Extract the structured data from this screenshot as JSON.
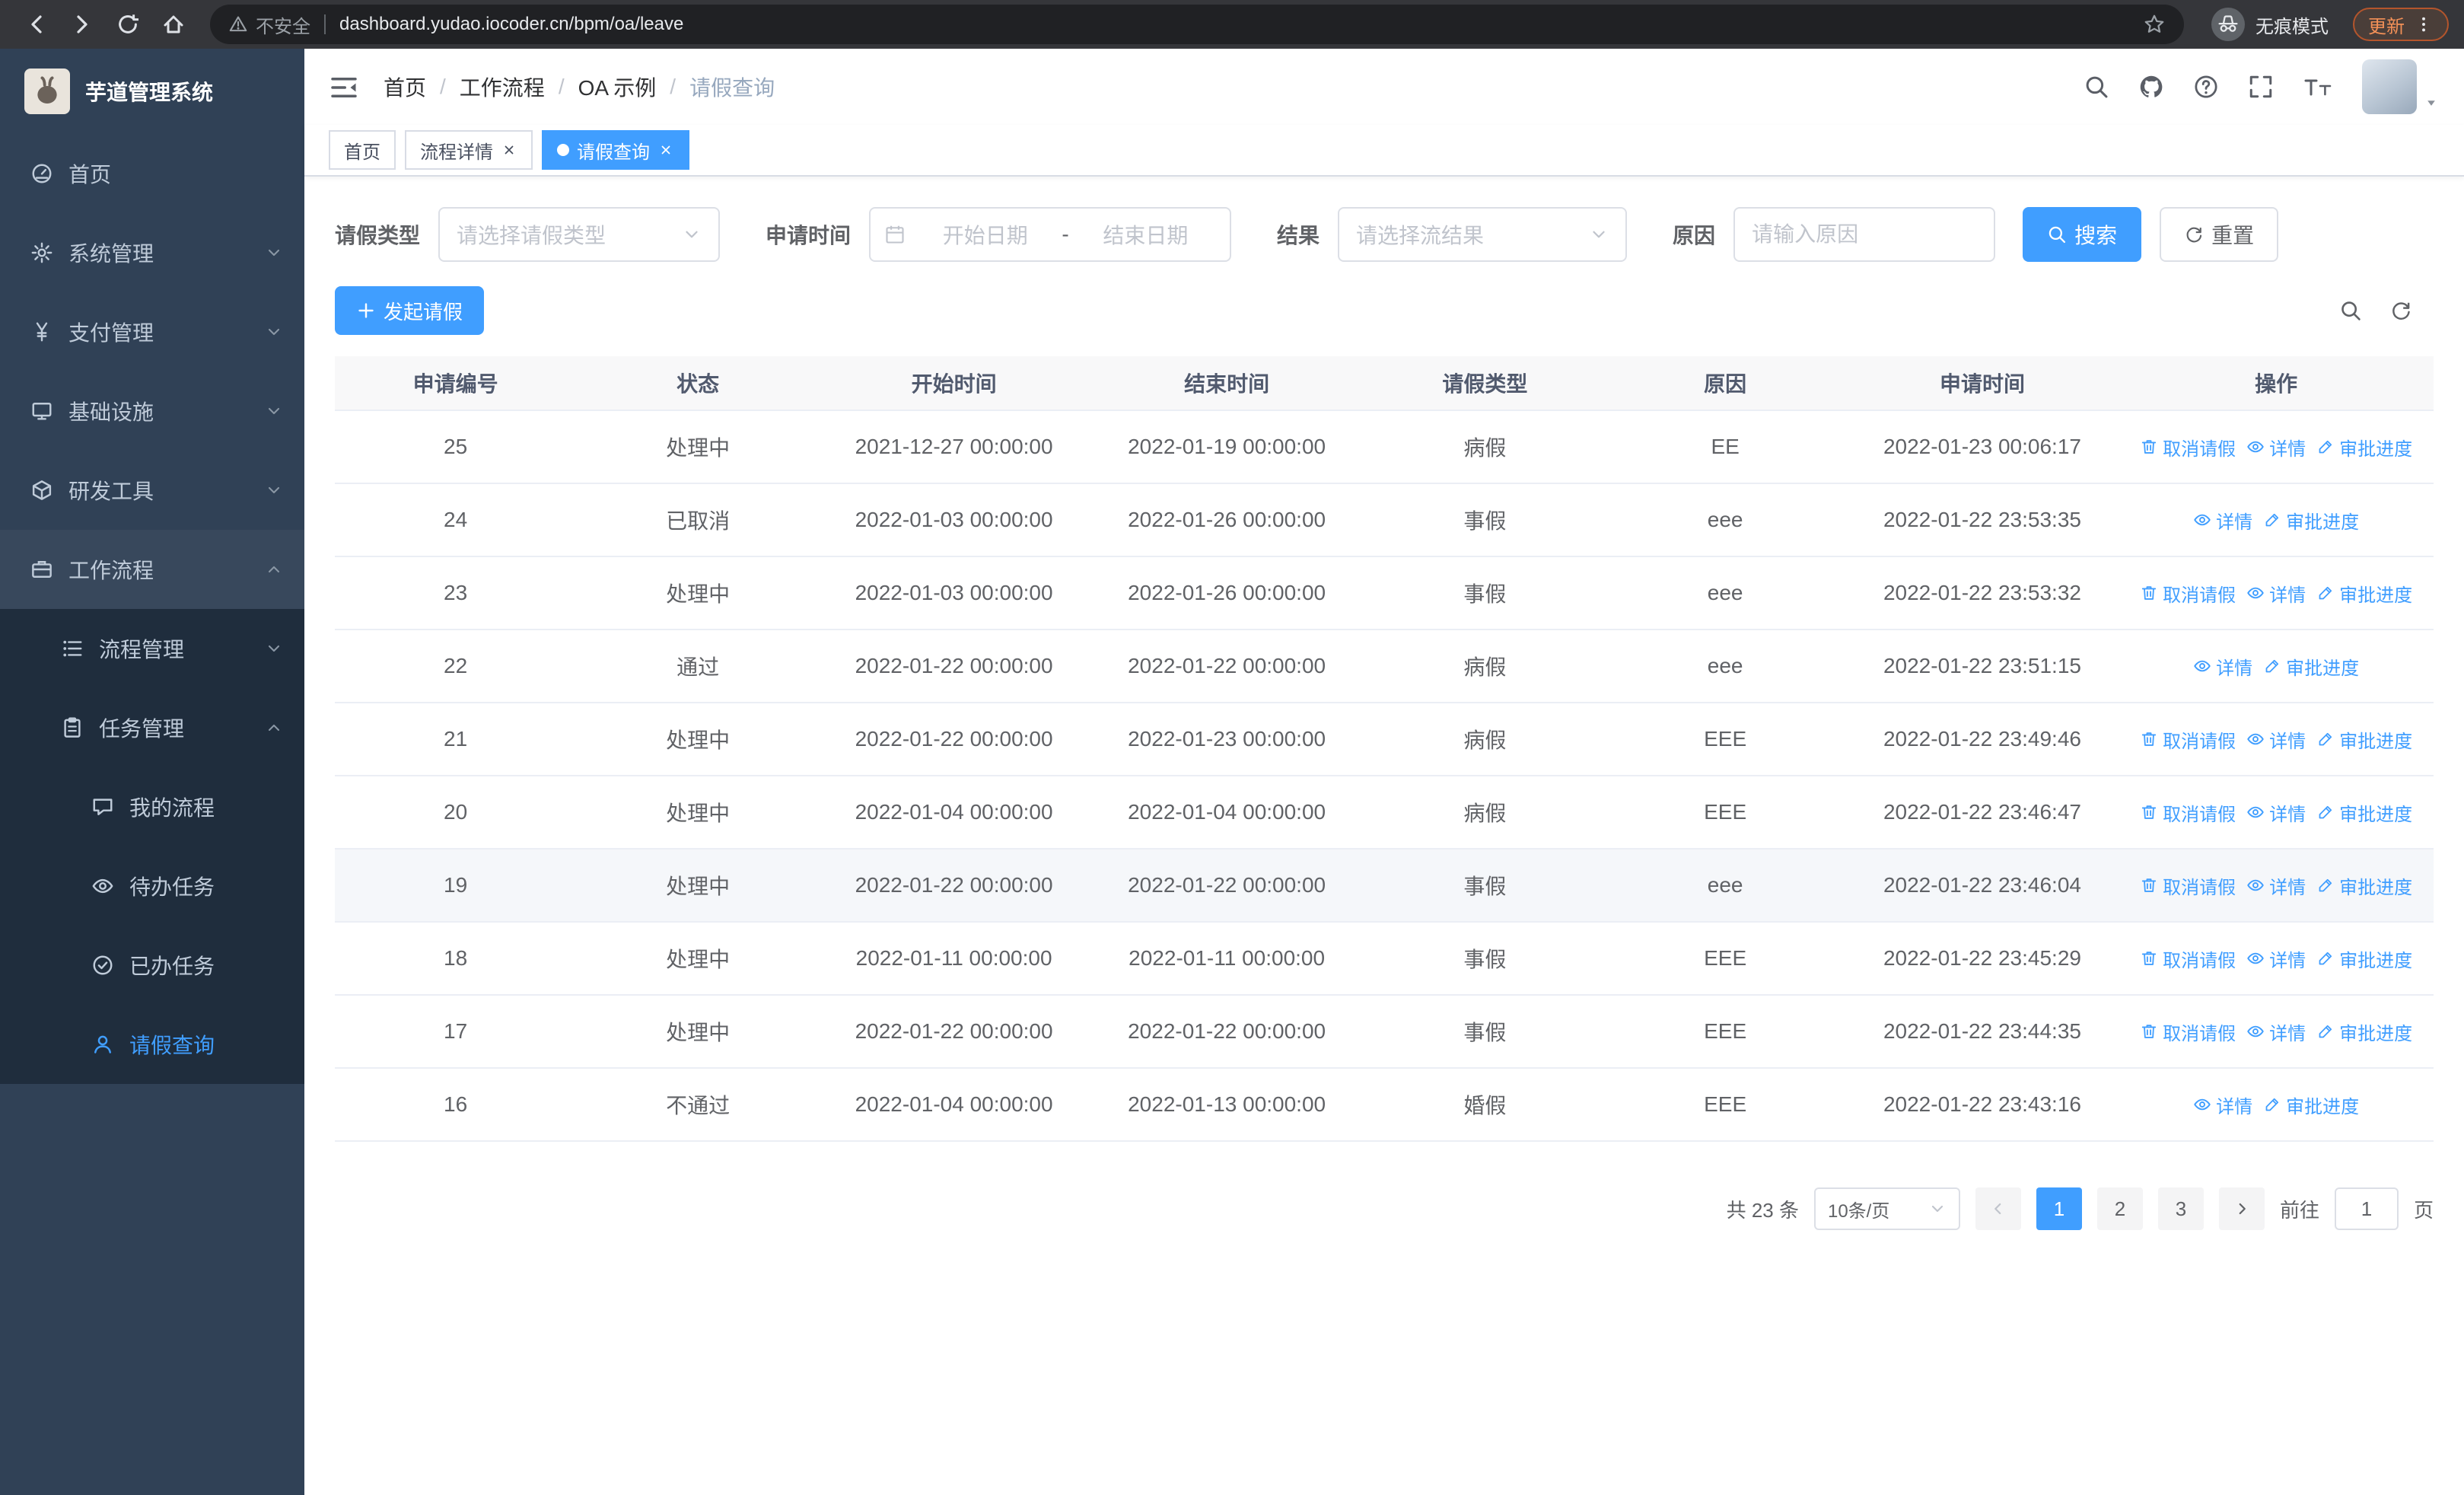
{
  "browser": {
    "security_warning": "不安全",
    "url": "dashboard.yudao.iocoder.cn/bpm/oa/leave",
    "incognito_label": "无痕模式",
    "update_label": "更新"
  },
  "sidebar": {
    "app_title": "芋道管理系统",
    "items": [
      {
        "label": "首页",
        "icon": "dashboard-icon",
        "level": 1
      },
      {
        "label": "系统管理",
        "icon": "gear-icon",
        "level": 1,
        "chevron": "down"
      },
      {
        "label": "支付管理",
        "icon": "yen-icon",
        "level": 1,
        "chevron": "down"
      },
      {
        "label": "基础设施",
        "icon": "monitor-icon",
        "level": 1,
        "chevron": "down"
      },
      {
        "label": "研发工具",
        "icon": "cube-icon",
        "level": 1,
        "chevron": "down"
      },
      {
        "label": "工作流程",
        "icon": "briefcase-icon",
        "level": 1,
        "chevron": "up",
        "expanded": true
      },
      {
        "label": "流程管理",
        "icon": "list-tree-icon",
        "level": 2,
        "chevron": "down"
      },
      {
        "label": "任务管理",
        "icon": "clipboard-icon",
        "level": 2,
        "chevron": "up",
        "expanded": true
      },
      {
        "label": "我的流程",
        "icon": "chat-icon",
        "level": 3
      },
      {
        "label": "待办任务",
        "icon": "eye-icon",
        "level": 3
      },
      {
        "label": "已办任务",
        "icon": "check-circle-icon",
        "level": 3
      },
      {
        "label": "请假查询",
        "icon": "user-icon",
        "level": 3,
        "active": true
      }
    ]
  },
  "header": {
    "breadcrumb": [
      "首页",
      "工作流程",
      "OA 示例",
      "请假查询"
    ],
    "breadcrumb_separator": "/"
  },
  "tabs": [
    {
      "label": "首页",
      "closable": false,
      "active": false
    },
    {
      "label": "流程详情",
      "closable": true,
      "active": false
    },
    {
      "label": "请假查询",
      "closable": true,
      "active": true
    }
  ],
  "filters": {
    "leave_type_label": "请假类型",
    "leave_type_placeholder": "请选择请假类型",
    "apply_time_label": "申请时间",
    "start_date_placeholder": "开始日期",
    "date_separator": "-",
    "end_date_placeholder": "结束日期",
    "result_label": "结果",
    "result_placeholder": "请选择流结果",
    "reason_label": "原因",
    "reason_placeholder": "请输入原因",
    "search_button": "搜索",
    "reset_button": "重置"
  },
  "toolbar": {
    "create_button": "发起请假"
  },
  "table": {
    "columns": [
      "申请编号",
      "状态",
      "开始时间",
      "结束时间",
      "请假类型",
      "原因",
      "申请时间",
      "操作"
    ],
    "action_labels": {
      "cancel": "取消请假",
      "detail": "详情",
      "progress": "审批进度"
    },
    "rows": [
      {
        "id": "25",
        "status": "处理中",
        "start": "2021-12-27 00:00:00",
        "end": "2022-01-19 00:00:00",
        "type": "病假",
        "reason": "EE",
        "applyTime": "2022-01-23 00:06:17",
        "cancellable": true
      },
      {
        "id": "24",
        "status": "已取消",
        "start": "2022-01-03 00:00:00",
        "end": "2022-01-26 00:00:00",
        "type": "事假",
        "reason": "eee",
        "applyTime": "2022-01-22 23:53:35",
        "cancellable": false
      },
      {
        "id": "23",
        "status": "处理中",
        "start": "2022-01-03 00:00:00",
        "end": "2022-01-26 00:00:00",
        "type": "事假",
        "reason": "eee",
        "applyTime": "2022-01-22 23:53:32",
        "cancellable": true
      },
      {
        "id": "22",
        "status": "通过",
        "start": "2022-01-22 00:00:00",
        "end": "2022-01-22 00:00:00",
        "type": "病假",
        "reason": "eee",
        "applyTime": "2022-01-22 23:51:15",
        "cancellable": false
      },
      {
        "id": "21",
        "status": "处理中",
        "start": "2022-01-22 00:00:00",
        "end": "2022-01-23 00:00:00",
        "type": "病假",
        "reason": "EEE",
        "applyTime": "2022-01-22 23:49:46",
        "cancellable": true
      },
      {
        "id": "20",
        "status": "处理中",
        "start": "2022-01-04 00:00:00",
        "end": "2022-01-04 00:00:00",
        "type": "病假",
        "reason": "EEE",
        "applyTime": "2022-01-22 23:46:47",
        "cancellable": true
      },
      {
        "id": "19",
        "status": "处理中",
        "start": "2022-01-22 00:00:00",
        "end": "2022-01-22 00:00:00",
        "type": "事假",
        "reason": "eee",
        "applyTime": "2022-01-22 23:46:04",
        "cancellable": true,
        "hover": true
      },
      {
        "id": "18",
        "status": "处理中",
        "start": "2022-01-11 00:00:00",
        "end": "2022-01-11 00:00:00",
        "type": "事假",
        "reason": "EEE",
        "applyTime": "2022-01-22 23:45:29",
        "cancellable": true
      },
      {
        "id": "17",
        "status": "处理中",
        "start": "2022-01-22 00:00:00",
        "end": "2022-01-22 00:00:00",
        "type": "事假",
        "reason": "EEE",
        "applyTime": "2022-01-22 23:44:35",
        "cancellable": true
      },
      {
        "id": "16",
        "status": "不通过",
        "start": "2022-01-04 00:00:00",
        "end": "2022-01-13 00:00:00",
        "type": "婚假",
        "reason": "EEE",
        "applyTime": "2022-01-22 23:43:16",
        "cancellable": false
      }
    ]
  },
  "pagination": {
    "total_text": "共 23 条",
    "page_size": "10条/页",
    "pages": [
      "1",
      "2",
      "3"
    ],
    "active_page": "1",
    "goto_label": "前往",
    "goto_value": "1",
    "goto_suffix": "页"
  },
  "colors": {
    "accent": "#409eff",
    "sidebar_bg": "#304156",
    "sidebar_sub_bg": "#1f2d3d",
    "chrome_bg": "#35363a",
    "urlbar_bg": "#202124",
    "update_chip": "#f29057",
    "table_header_bg": "#f8f8f9",
    "hover_row_bg": "#f5f7fa"
  }
}
